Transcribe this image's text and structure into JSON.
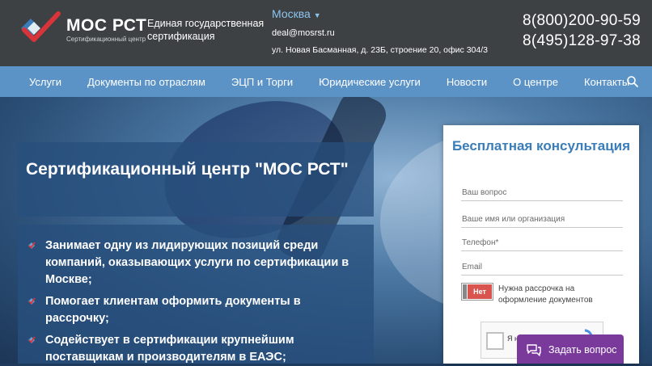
{
  "header": {
    "brand": "МОС РСТ",
    "brand_sub": "Сертификационный центр",
    "tagline": "Единая государственная сертификация",
    "city": "Москва",
    "email": "deal@mosrst.ru",
    "address": "ул. Новая Басманная, д. 23Б, строение 20, офис 304/3",
    "phone1": "8(800)200-90-59",
    "phone2": "8(495)128-97-38"
  },
  "nav": {
    "items": [
      "Услуги",
      "Документы по отраслям",
      "ЭЦП и Торги",
      "Юридические услуги",
      "Новости",
      "О центре",
      "Контакты"
    ]
  },
  "hero": {
    "title": "Сертификационный центр \"МОС РСТ\"",
    "points": [
      "Занимает одну из лидирующих позиций среди компаний, оказывающих услуги по сертификации в Москве;",
      "Помогает клиентам оформить документы в рассрочку;",
      "Содействует в сертификации крупнейшим поставщикам и производителям в ЕАЭС;"
    ]
  },
  "form": {
    "title": "Бесплатная консультация",
    "question_placeholder": "Ваш вопрос",
    "name_placeholder": "Ваше имя или организация",
    "phone_placeholder": "Телефон*",
    "email_placeholder": "Email",
    "toggle_state": "Нет",
    "toggle_text": "Нужна рассрочка на оформление документов",
    "captcha_text": "Я не"
  },
  "chat": {
    "label": "Задать вопрос"
  },
  "colors": {
    "header_bg": "#3e4144",
    "nav_bg": "#5c93c7",
    "accent": "#3a7db8",
    "toggle_red": "#d9534f",
    "chat_purple": "#7a3a9c"
  }
}
